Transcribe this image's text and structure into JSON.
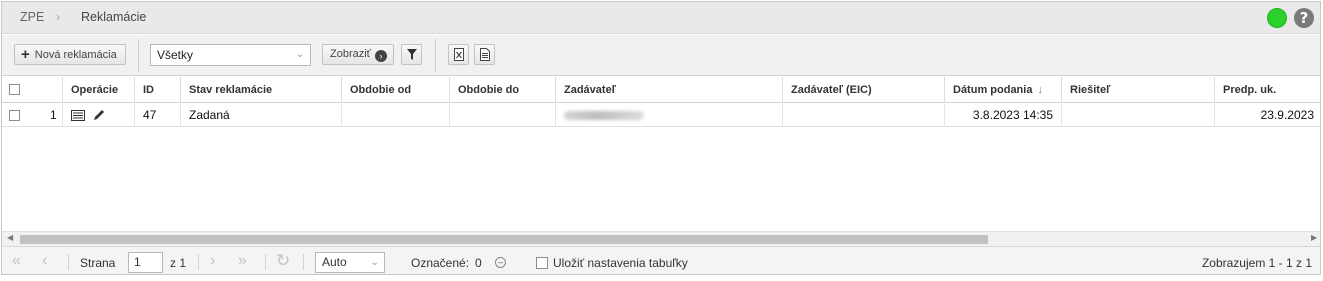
{
  "breadcrumb": {
    "root": "ZPE",
    "separator": "›",
    "current": "Reklamácie"
  },
  "header": {
    "status_color": "#2bd12b",
    "help_symbol": "?"
  },
  "toolbar": {
    "new_label": "Nová reklamácia",
    "new_icon": "+",
    "filter_select_value": "Všetky",
    "show_label": "Zobraziť",
    "show_icon": "›",
    "filter_icon": "filter-icon",
    "xls_icon": "excel-export-icon",
    "doc_icon": "document-export-icon"
  },
  "table": {
    "columns": [
      "Operácie",
      "ID",
      "Stav reklamácie",
      "Obdobie od",
      "Obdobie do",
      "Zadávateľ",
      "Zadávateľ (EIC)",
      "Dátum podania",
      "Riešiteľ",
      "Predp. uk."
    ],
    "sort_indicator": "↓",
    "rows": [
      {
        "num": "1",
        "id": "47",
        "stav": "Zadaná",
        "obdobie_od": "",
        "obdobie_do": "",
        "zadavatel_eic": "",
        "datum_podania": "3.8.2023 14:35",
        "riesitel": "",
        "predp_uk": "23.9.2023"
      }
    ]
  },
  "pager": {
    "page_label": "Strana",
    "page_value": "1",
    "of_label": "z 1",
    "page_size": "Auto",
    "selected_label": "Označené:",
    "selected_count": "0",
    "save_settings_label": "Uložiť nastavenia tabuľky",
    "summary": "Zobrazujem 1 - 1 z 1"
  }
}
